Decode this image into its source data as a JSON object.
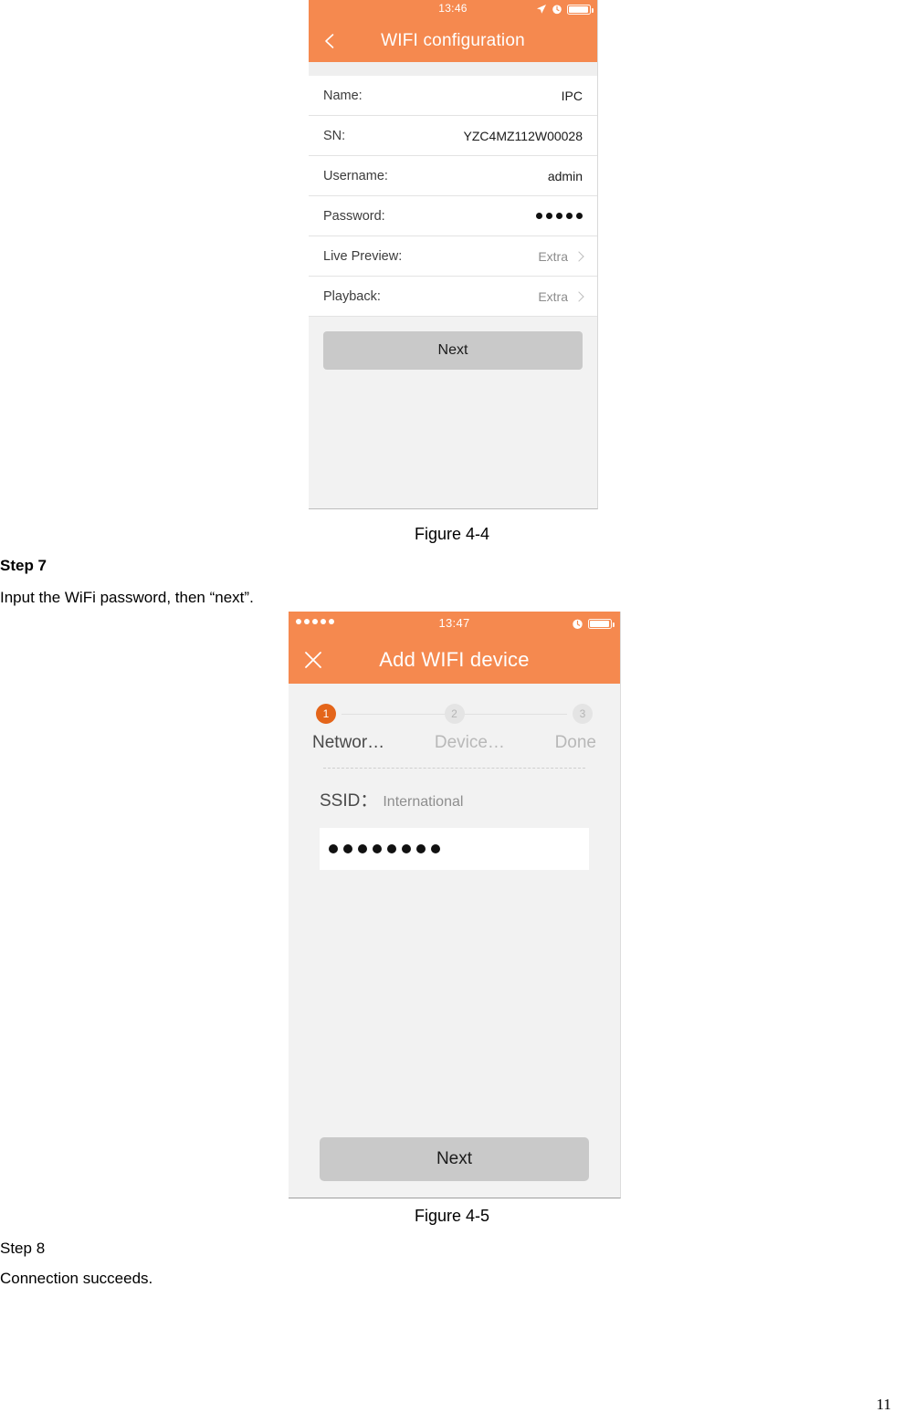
{
  "document": {
    "page_number": "11"
  },
  "figure1": {
    "caption": "Figure 4-4",
    "screen": {
      "status_bar": {
        "time": "13:46",
        "icons": [
          "location-arrow-icon",
          "alarm-clock-icon",
          "battery-icon"
        ]
      },
      "nav": {
        "back_icon": "chevron-left-icon",
        "title": "WIFI configuration"
      },
      "rows": [
        {
          "label": "Name:",
          "value": "IPC",
          "type": "text"
        },
        {
          "label": "SN:",
          "value": "YZC4MZ112W00028",
          "type": "text"
        },
        {
          "label": "Username:",
          "value": "admin",
          "type": "text"
        },
        {
          "label": "Password:",
          "value": "",
          "type": "password",
          "dot_count": 5
        },
        {
          "label": "Live Preview:",
          "value": "Extra",
          "type": "link"
        },
        {
          "label": "Playback:",
          "value": "Extra",
          "type": "link"
        }
      ],
      "next_button": "Next"
    }
  },
  "step7": {
    "heading": "Step 7",
    "text": "Input the WiFi password, then “next”."
  },
  "figure2": {
    "caption": "Figure 4-5",
    "screen": {
      "status_bar": {
        "signal_dots": 5,
        "time": "13:47",
        "icons": [
          "alarm-clock-icon",
          "battery-icon"
        ]
      },
      "nav": {
        "close_icon": "close-x-icon",
        "title": "Add WIFI device"
      },
      "stepper": [
        {
          "number": "1",
          "label": "Networ…",
          "active": true
        },
        {
          "number": "2",
          "label": "Device…",
          "active": false
        },
        {
          "number": "3",
          "label": "Done",
          "active": false
        }
      ],
      "ssid_label": "SSID：",
      "ssid_value": "International",
      "password_dot_count": 8,
      "next_button": "Next"
    }
  },
  "step8": {
    "heading": "Step 8",
    "text": "Connection succeeds."
  },
  "colors": {
    "header_orange": "#f5894f",
    "active_step_orange": "#e4651a",
    "button_gray": "#c9c9c9",
    "screen_bg": "#f2f2f2"
  }
}
